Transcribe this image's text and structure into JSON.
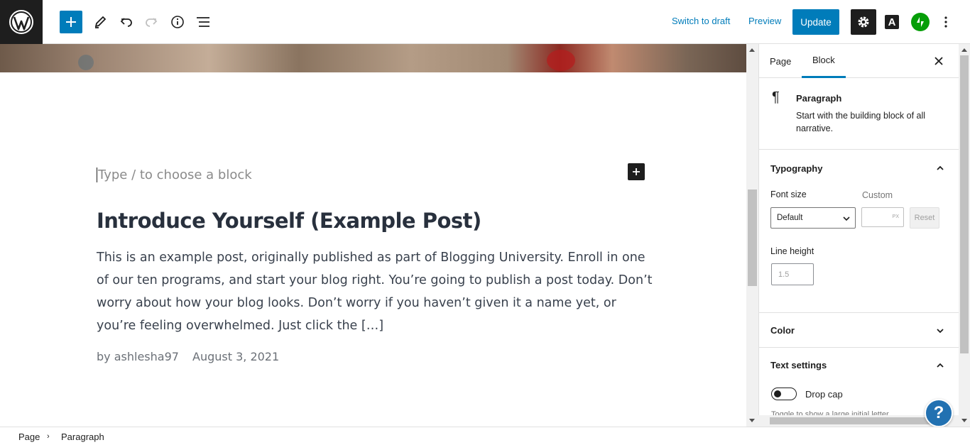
{
  "toolbar": {
    "switch_to_draft": "Switch to draft",
    "preview": "Preview",
    "update": "Update",
    "a_icon_label": "A"
  },
  "editor": {
    "placeholder": "Type / to choose a block",
    "post_title": "Introduce Yourself (Example Post)",
    "post_excerpt": "This is an example post, originally published as part of Blogging University. Enroll in one of our ten programs, and start your blog right. You’re going to publish a post today. Don’t worry about how your blog looks. Don’t worry if you haven’t given it a name yet, or you’re feeling overwhelmed. Just click the […]",
    "author": "by ashlesha97",
    "date": "August 3, 2021"
  },
  "sidebar": {
    "tabs": [
      {
        "label": "Page",
        "active": false
      },
      {
        "label": "Block",
        "active": true
      }
    ],
    "block_card": {
      "title": "Paragraph",
      "description": "Start with the building block of all narrative."
    },
    "typography": {
      "title": "Typography",
      "font_size_label": "Font size",
      "custom_label": "Custom",
      "font_size_value": "Default",
      "custom_unit": "PX",
      "reset_label": "Reset",
      "line_height_label": "Line height",
      "line_height_placeholder": "1.5"
    },
    "color": {
      "title": "Color"
    },
    "text_settings": {
      "title": "Text settings",
      "drop_cap_label": "Drop cap",
      "drop_cap_help": "Toggle to show a large initial letter."
    }
  },
  "help_button": "?",
  "breadcrumb": [
    "Page",
    "Paragraph"
  ],
  "colors": {
    "accent": "#007cba",
    "dark": "#1e1e1e",
    "jetpack": "#069e08"
  }
}
